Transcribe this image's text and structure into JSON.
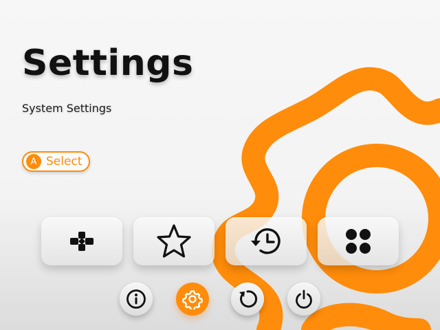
{
  "header": {
    "title": "Settings",
    "subtitle": "System Settings"
  },
  "hint": {
    "button_glyph": "A",
    "label": "Select"
  },
  "tiles": [
    {
      "icon": "gamepad-icon"
    },
    {
      "icon": "star-icon"
    },
    {
      "icon": "history-icon"
    },
    {
      "icon": "apps-grid-icon"
    }
  ],
  "bottom_nav": [
    {
      "icon": "info-icon",
      "active": false
    },
    {
      "icon": "gear-icon",
      "active": true
    },
    {
      "icon": "refresh-icon",
      "active": false
    },
    {
      "icon": "power-icon",
      "active": false
    }
  ],
  "colors": {
    "accent": "#ff8c0a",
    "text": "#111111",
    "background": "#f5f5f5"
  }
}
